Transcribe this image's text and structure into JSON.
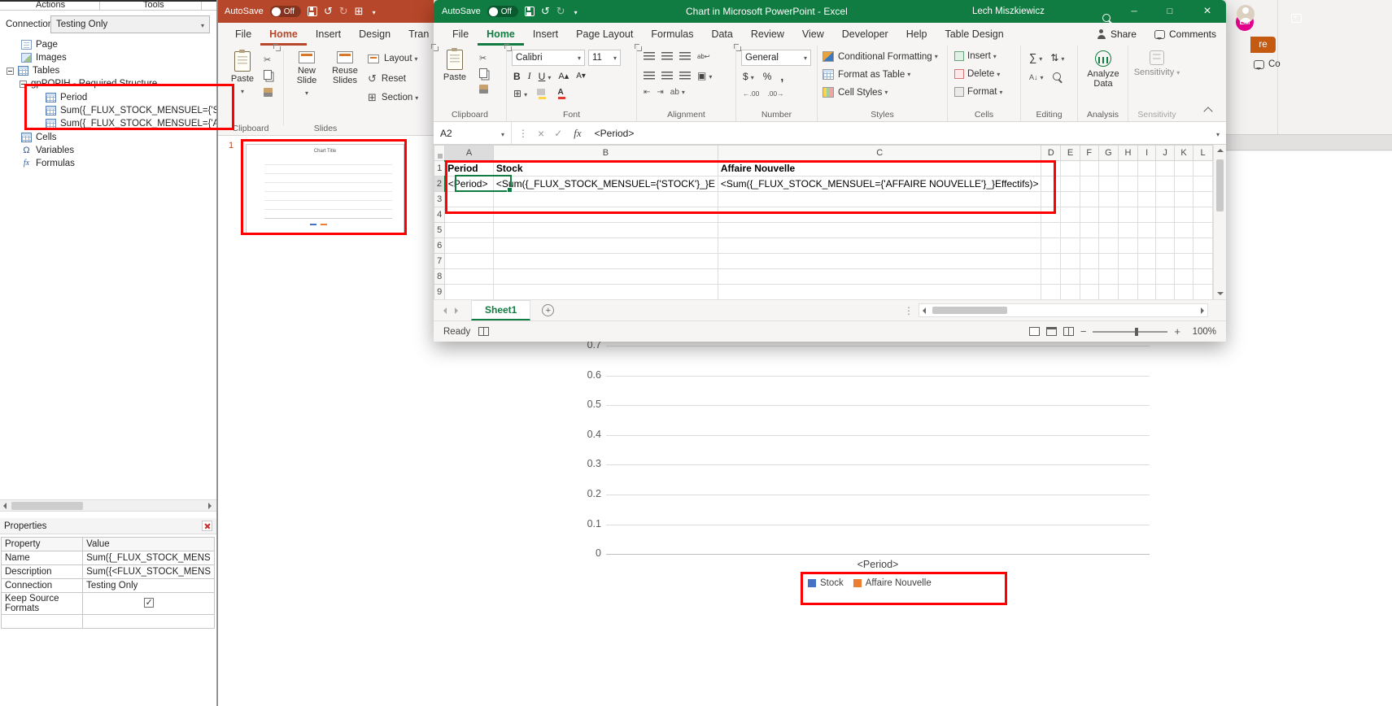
{
  "colors": {
    "excel_green": "#107c41",
    "ppt_red": "#b7472a",
    "annotation_red": "#ff0000",
    "avatar_pink": "#e3008c",
    "share_orange": "#c55a11"
  },
  "addin": {
    "menubar": {
      "actions": "Actions",
      "tools": "Tools"
    },
    "connection": {
      "label": "Connection",
      "value": "Testing Only"
    },
    "tree": {
      "page": "Page",
      "images": "Images",
      "tables": "Tables",
      "group": "gpPOPIH - Required Structure",
      "items": [
        "Period",
        "Sum({_FLUX_STOCK_MENSUEL={'STOC",
        "Sum({_FLUX_STOCK_MENSUEL={'AFFAI"
      ],
      "cells": "Cells",
      "variables": "Variables",
      "formulas": "Formulas"
    },
    "properties": {
      "title": "Properties",
      "columns": [
        "Property",
        "Value"
      ],
      "rows": [
        {
          "property": "Name",
          "value": "Sum({_FLUX_STOCK_MENS"
        },
        {
          "property": "Description",
          "value": "Sum({<FLUX_STOCK_MENS"
        },
        {
          "property": "Connection",
          "value": "Testing Only"
        },
        {
          "property": "Keep Source Formats",
          "value": "",
          "checked": true
        }
      ]
    }
  },
  "ppt": {
    "titlebar": {
      "autosave": "AutoSave",
      "autosave_state": "Off"
    },
    "tabs": [
      "File",
      "Home",
      "Insert",
      "Design",
      "Tran"
    ],
    "ribbon": {
      "paste": "Paste",
      "new_slide": "New Slide",
      "reuse_slides": "Reuse Slides",
      "layout": "Layout",
      "reset": "Reset",
      "section": "Section",
      "groups": {
        "clipboard": "Clipboard",
        "slides": "Slides"
      }
    },
    "slide_number": "1",
    "thumbnail_title": "Chart Title"
  },
  "excel": {
    "titlebar": {
      "autosave": "AutoSave",
      "autosave_state": "Off",
      "title": "Chart in Microsoft PowerPoint  -  Excel",
      "user": "Lech Miszkiewicz"
    },
    "tabs": [
      "File",
      "Home",
      "Insert",
      "Page Layout",
      "Formulas",
      "Data",
      "Review",
      "View",
      "Developer",
      "Help",
      "Table Design"
    ],
    "actions": {
      "share": "Share",
      "comments": "Comments"
    },
    "ribbon": {
      "paste": "Paste",
      "font_name": "Calibri",
      "font_size": "11",
      "number_format": "General",
      "conditional_formatting": "Conditional Formatting",
      "format_as_table": "Format as Table",
      "cell_styles": "Cell Styles",
      "insert": "Insert",
      "delete": "Delete",
      "format": "Format",
      "analyze_data": "Analyze Data",
      "sensitivity": "Sensitivity",
      "groups": {
        "clipboard": "Clipboard",
        "font": "Font",
        "alignment": "Alignment",
        "number": "Number",
        "styles": "Styles",
        "cells": "Cells",
        "editing": "Editing",
        "analysis": "Analysis",
        "sensitivity": "Sensitivity"
      }
    },
    "formula_bar": {
      "name_box": "A2",
      "value": "<Period>"
    },
    "grid": {
      "columns": [
        "A",
        "B",
        "C",
        "D",
        "E",
        "F",
        "G",
        "H",
        "I",
        "J",
        "K",
        "L"
      ],
      "rows": [
        "1",
        "2",
        "3",
        "4",
        "5",
        "6",
        "7",
        "8",
        "9"
      ],
      "cells": {
        "A1": "Period",
        "B1": "Stock",
        "C1": "Affaire Nouvelle",
        "A2": "<Period>",
        "B2": "<Sum({_FLUX_STOCK_MENSUEL={'STOCK'}_}E",
        "C2": "<Sum({_FLUX_STOCK_MENSUEL={'AFFAIRE NOUVELLE'}_}Effectifs)>"
      }
    },
    "sheet": {
      "tab": "Sheet1",
      "status": "Ready",
      "zoom": "100%"
    }
  },
  "right_strip": {
    "avatar": "LM",
    "share_fragment": "re",
    "comments_fragment": "Co"
  },
  "chart_data": {
    "type": "bar",
    "title": "",
    "categories": [
      "<Period>"
    ],
    "series": [
      {
        "name": "Stock",
        "color": "#4472c4",
        "values": []
      },
      {
        "name": "Affaire Nouvelle",
        "color": "#ed7d31",
        "values": []
      }
    ],
    "xlabel": "<Period>",
    "y_ticks": [
      "0.7",
      "0.6",
      "0.5",
      "0.4",
      "0.3",
      "0.2",
      "0.1",
      "0"
    ],
    "ylim": [
      0,
      0.7
    ],
    "legend_position": "bottom",
    "gridlines": true
  }
}
